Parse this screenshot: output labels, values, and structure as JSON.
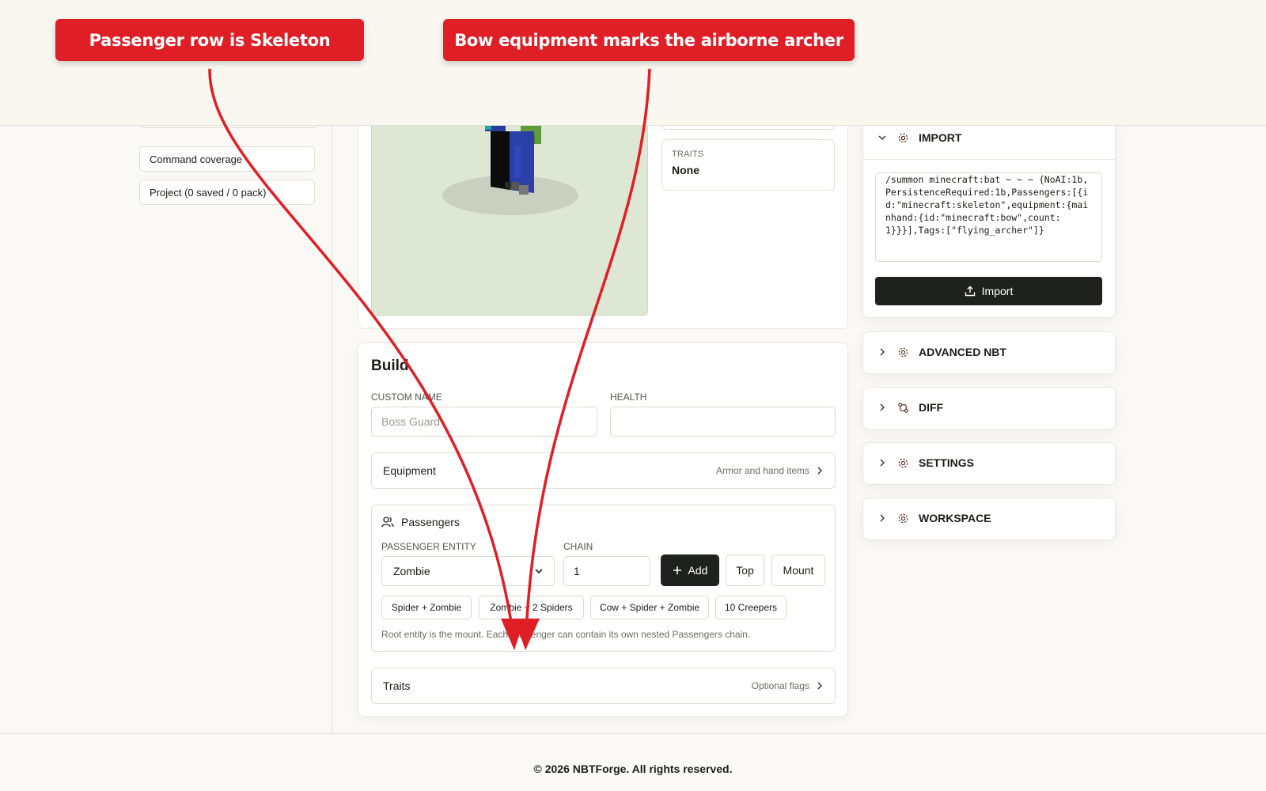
{
  "annotations": {
    "callout_left": "Passenger row is Skeleton",
    "callout_right": "Bow equipment marks the airborne archer"
  },
  "sidebar": {
    "items": [
      "Command coverage",
      "Project (0 saved / 0 pack)"
    ]
  },
  "preview": {
    "traits_label": "TRAITS",
    "traits_value": "None"
  },
  "build": {
    "title": "Build",
    "custom_name_label": "CUSTOM NAME",
    "custom_name_placeholder": "Boss Guard",
    "custom_name_value": "",
    "health_label": "HEALTH",
    "health_value": "",
    "equipment": {
      "label": "Equipment",
      "hint": "Armor and hand items"
    },
    "passengers": {
      "title": "Passengers",
      "entity_label": "PASSENGER ENTITY",
      "entity_value": "Zombie",
      "chain_label": "CHAIN",
      "chain_value": "1",
      "add_label": "Add",
      "top_label": "Top",
      "mount_label": "Mount",
      "presets": [
        "Spider + Zombie",
        "Zombie + 2 Spiders",
        "Cow + Spider + Zombie",
        "10 Creepers"
      ],
      "help": "Root entity is the mount. Each passenger can contain its own nested Passengers chain."
    },
    "traits": {
      "label": "Traits",
      "hint": "Optional flags"
    }
  },
  "right_panel": {
    "import": {
      "title": "IMPORT",
      "command": "/summon minecraft:bat ~ ~ ~ {NoAI:1b,PersistenceRequired:1b,Passengers:[{id:\"minecraft:skeleton\",equipment:{mainhand:{id:\"minecraft:bow\",count:1}}}],Tags:[\"flying_archer\"]}",
      "button_label": "Import"
    },
    "sections": [
      "ADVANCED NBT",
      "DIFF",
      "SETTINGS",
      "WORKSPACE"
    ]
  },
  "footer": {
    "text": "© 2026 NBTForge. All rights reserved."
  },
  "colors": {
    "accent_red": "#e01e26",
    "dark_button": "#1f211e",
    "preview_bg": "#dee7d3"
  }
}
